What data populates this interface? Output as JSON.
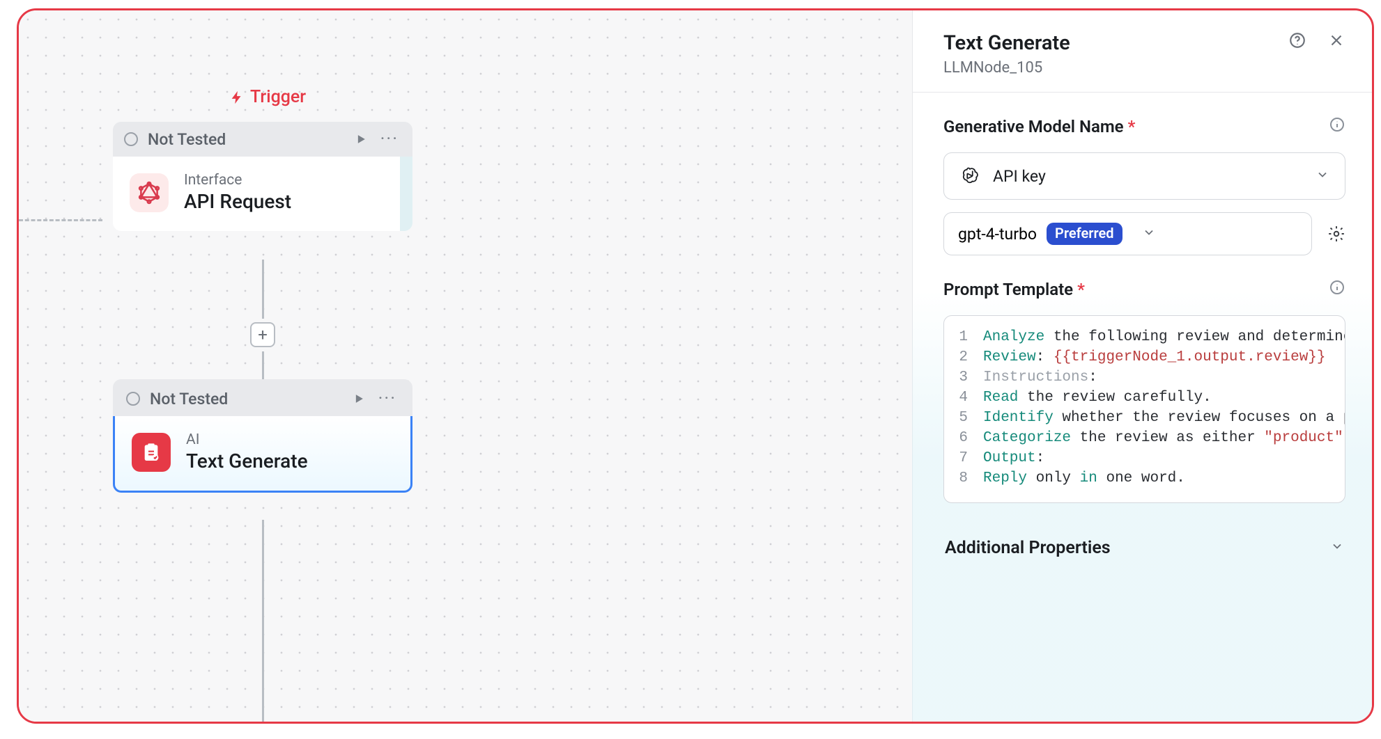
{
  "canvas": {
    "trigger_label": "Trigger",
    "nodes": [
      {
        "status": "Not Tested",
        "category": "Interface",
        "name": "API Request",
        "icon": "graphql-icon",
        "selected": false
      },
      {
        "status": "Not Tested",
        "category": "AI",
        "name": "Text Generate",
        "icon": "clipboard-ai-icon",
        "selected": true
      }
    ]
  },
  "panel": {
    "title": "Text Generate",
    "subtitle": "LLMNode_105",
    "fields": {
      "model_name_label": "Generative Model Name",
      "api_key_label": "API key",
      "model_value": "gpt-4-turbo",
      "model_badge": "Preferred",
      "prompt_template_label": "Prompt Template"
    },
    "prompt_lines": [
      {
        "n": "1",
        "tokens": [
          [
            "kw",
            "Analyze"
          ],
          [
            "txt",
            " the following review and determine"
          ]
        ]
      },
      {
        "n": "2",
        "tokens": [
          [
            "kw",
            "Review"
          ],
          [
            "txt",
            ": "
          ],
          [
            "var",
            "{{triggerNode_1.output.review}}"
          ]
        ]
      },
      {
        "n": "3",
        "tokens": [
          [
            "lbl",
            "Instructions"
          ],
          [
            "txt",
            ":"
          ]
        ]
      },
      {
        "n": "4",
        "tokens": [
          [
            "kw",
            "Read"
          ],
          [
            "txt",
            " the review carefully."
          ]
        ]
      },
      {
        "n": "5",
        "tokens": [
          [
            "kw",
            "Identify"
          ],
          [
            "txt",
            " whether the review focuses on a p"
          ]
        ]
      },
      {
        "n": "6",
        "tokens": [
          [
            "kw",
            "Categorize"
          ],
          [
            "txt",
            " the review as either "
          ],
          [
            "str",
            "\"product\""
          ]
        ]
      },
      {
        "n": "7",
        "tokens": [
          [
            "kw",
            "Output"
          ],
          [
            "txt",
            ":"
          ]
        ]
      },
      {
        "n": "8",
        "tokens": [
          [
            "kw",
            "Reply"
          ],
          [
            "txt",
            " only "
          ],
          [
            "in",
            "in"
          ],
          [
            "txt",
            " one word."
          ]
        ]
      }
    ],
    "additional_properties_label": "Additional Properties"
  }
}
